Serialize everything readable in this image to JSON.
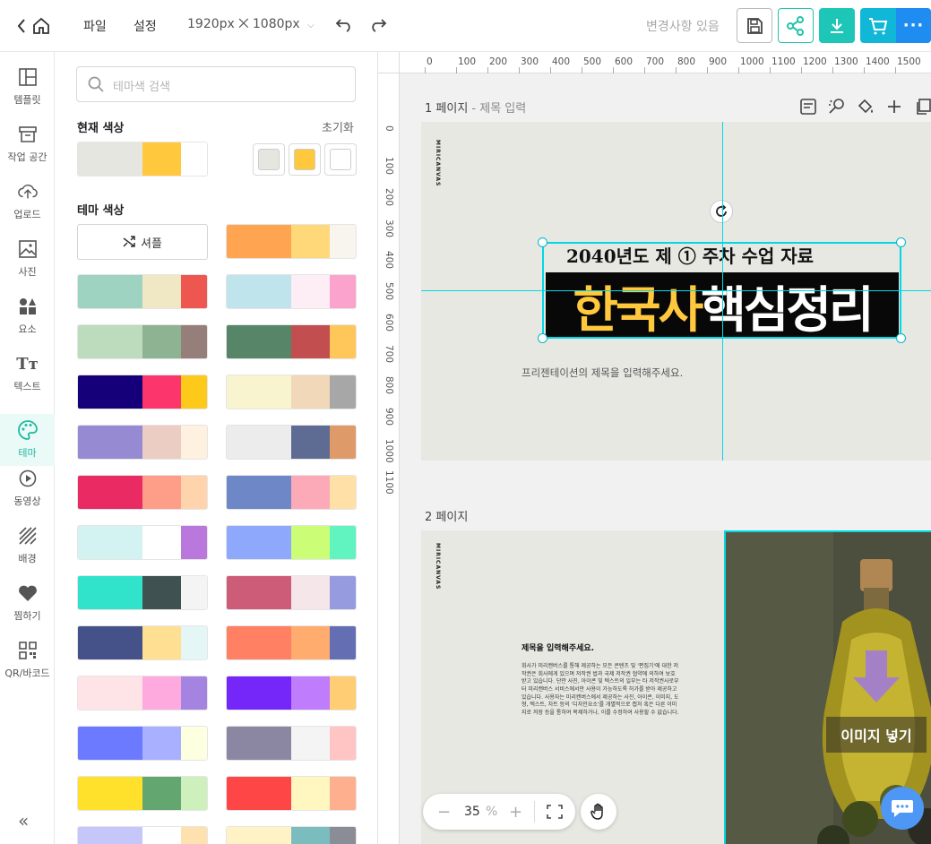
{
  "topbar": {
    "file_label": "파일",
    "settings_label": "설정",
    "canvas_size": "1920px ⨉ 1080px",
    "changes_status": "변경사항 있음"
  },
  "colors": {
    "accent": "#21c4a9",
    "download": "#1ec6b8",
    "cart": "#11b7d6",
    "more": "#1e8cf0",
    "guide": "#00d8e6",
    "title_yellow": "#ffc83d"
  },
  "nav": [
    {
      "label": "템플릿",
      "icon": "template-icon"
    },
    {
      "label": "작업 공간",
      "icon": "workspace-icon"
    },
    {
      "label": "업로드",
      "icon": "upload-icon"
    },
    {
      "label": "사진",
      "icon": "photo-icon"
    },
    {
      "label": "요소",
      "icon": "elements-icon"
    },
    {
      "label": "텍스트",
      "icon": "text-icon"
    },
    {
      "label": "테마",
      "icon": "palette-icon",
      "active": true
    },
    {
      "label": "동영상",
      "icon": "video-icon"
    },
    {
      "label": "배경",
      "icon": "background-icon"
    },
    {
      "label": "찜하기",
      "icon": "heart-icon"
    },
    {
      "label": "QR/바코드",
      "icon": "qr-icon"
    }
  ],
  "panel": {
    "search_placeholder": "테마색 검색",
    "current_colors_title": "현재 색상",
    "reset_label": "초기화",
    "current_colors": [
      "#e6e6e0",
      "#ffc83d",
      "#ffffff"
    ],
    "theme_colors_title": "테마 색상",
    "shuffle_label": "셔플",
    "themes": [
      [
        "#ffa552",
        "#ffd87a",
        "#f8f5ef"
      ],
      [
        "#9ed3c1",
        "#f0e8c4",
        "#ee5650"
      ],
      [
        "#c0e4ec",
        "#fdeef6",
        "#fba3cc"
      ],
      [
        "#bddcbe",
        "#8db392",
        "#967f7a"
      ],
      [
        "#568567",
        "#c24e50",
        "#ffc75a"
      ],
      [
        "#150079",
        "#fc356d",
        "#fdca1b"
      ],
      [
        "#f8f4cf",
        "#f0d8b8",
        "#a7a7a7"
      ],
      [
        "#968bd3",
        "#ebcdc3",
        "#fff1e0"
      ],
      [
        "#ececec",
        "#5e6c94",
        "#df9a69"
      ],
      [
        "#ea2a62",
        "#fe9e89",
        "#ffd4ad"
      ],
      [
        "#6e88c7",
        "#fdaab8",
        "#ffe0a7"
      ],
      [
        "#d2f3f1",
        "#ffffff",
        "#ba78dc"
      ],
      [
        "#8ea9fb",
        "#cbfd77",
        "#61f4c1"
      ],
      [
        "#30e3ca",
        "#3f5150",
        "#f4f4f4"
      ],
      [
        "#cc5c77",
        "#f5e6ea",
        "#969be0"
      ],
      [
        "#455189",
        "#ffdf91",
        "#e4f6f6"
      ],
      [
        "#ff8062",
        "#ffac6e",
        "#636fb2"
      ],
      [
        "#ffe4e7",
        "#feaadf",
        "#a583e0"
      ],
      [
        "#7526f8",
        "#bf7cfc",
        "#ffcd73"
      ],
      [
        "#6b7aff",
        "#a8b0ff",
        "#fcffe0"
      ],
      [
        "#8b87a2",
        "#f4f4f4",
        "#ffc5c5"
      ],
      [
        "#ffe02a",
        "#64a66f",
        "#cdf0bd"
      ],
      [
        "#fe4646",
        "#fff6c0",
        "#feaf8e"
      ],
      [
        "#c5c7fb",
        "#ffffff",
        "#ffe1b0"
      ],
      [
        "#fff3c6",
        "#7bbdbf",
        "#8a8d95"
      ]
    ]
  },
  "canvas": {
    "ruler_h": [
      "0",
      "100",
      "200",
      "300",
      "400",
      "500",
      "600",
      "700",
      "800",
      "900",
      "1000",
      "1100",
      "1200",
      "1300",
      "1400",
      "1500"
    ],
    "ruler_v": [
      "0",
      "100",
      "200",
      "300",
      "400",
      "500",
      "600",
      "700",
      "800",
      "900",
      "1000",
      "1100"
    ],
    "page1_label": "1 페이지",
    "page1_sub": " - 제목 입력",
    "page1_heading": "2040년도 제 ① 주차 수업 자료",
    "page1_title_yellow": "한국사",
    "page1_title_white": "핵심정리",
    "page1_caption": "프리젠테이션의 제목을 입력해주세요.",
    "page2_label": "2 페이지",
    "brand": "MIRICANVAS",
    "page2_title": "제목을 입력해주세요.",
    "page2_body": "회사가 미리캔버스를 통해 제공하는 모든 콘텐츠 및 '편집기'에 대한 저작권은 회사에게 있으며 저작권 법과 국제 저작권 협약에 의하여 보호받고 있습니다. 단만 사진, 아이콘 및 텍스트의 일부는 타 저작권사로부터 미리캔버스 서비스에서만 사용이 가능하도록 허가를 받아 제공하고 있습니다. 사용자는 미리캔버스에서 제공하는 사진, 아이콘, 이미지, 도형, 텍스트, 차트 등의 '디자인요소'를 개별적으로 캡처 혹은 다른 이미지로 저장 등을 통하여 복제하거나, 이를 수정하여 사용할 수 없습니다.",
    "image_insert_label": "이미지 넣기",
    "zoom_value": "35",
    "zoom_unit": "%"
  }
}
